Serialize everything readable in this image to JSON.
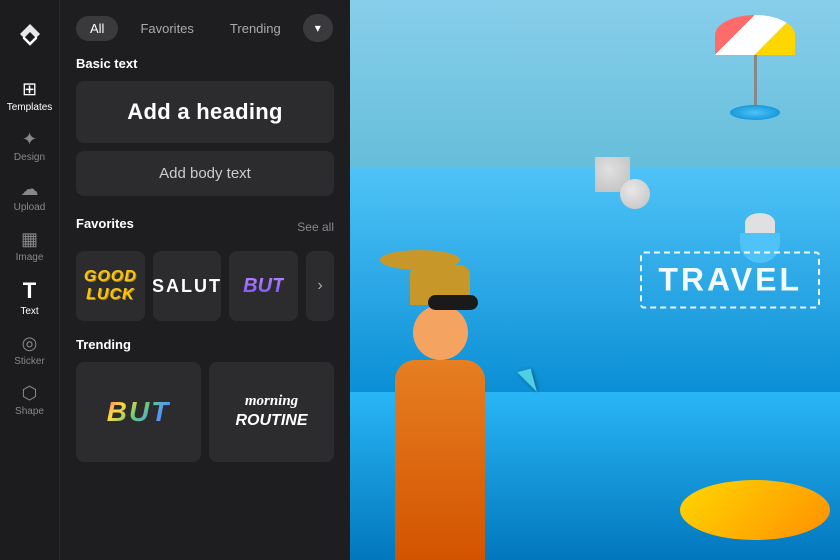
{
  "app": {
    "logo_symbol": "✂",
    "title": "CapCut"
  },
  "sidebar": {
    "items": [
      {
        "id": "templates",
        "label": "Templates",
        "icon": "⊞",
        "active": true
      },
      {
        "id": "design",
        "label": "Design",
        "icon": "✦",
        "active": false
      },
      {
        "id": "upload",
        "label": "Upload",
        "icon": "☁",
        "active": false
      },
      {
        "id": "image",
        "label": "Image",
        "icon": "▦",
        "active": false
      },
      {
        "id": "text",
        "label": "Text",
        "icon": "T",
        "active": true
      },
      {
        "id": "sticker",
        "label": "Sticker",
        "icon": "◎",
        "active": false
      },
      {
        "id": "shape",
        "label": "Shape",
        "icon": "⬡",
        "active": false
      }
    ]
  },
  "panel": {
    "filters": [
      {
        "id": "all",
        "label": "All",
        "active": true
      },
      {
        "id": "favorites",
        "label": "Favorites",
        "active": false
      },
      {
        "id": "trending",
        "label": "Trending",
        "active": false
      }
    ],
    "dropdown_icon": "▾",
    "sections": {
      "basic_text": {
        "title": "Basic text",
        "heading_btn": "Add a heading",
        "body_btn": "Add body text"
      },
      "favorites": {
        "title": "Favorites",
        "see_all": "See all",
        "items": [
          {
            "id": "good-luck",
            "text": "GOOD\nLUCK"
          },
          {
            "id": "salut",
            "text": "SALUT"
          },
          {
            "id": "but",
            "text": "BUT"
          }
        ],
        "arrow_icon": "›"
      },
      "trending": {
        "title": "Trending",
        "items": [
          {
            "id": "but-trend",
            "text": "BUT"
          },
          {
            "id": "morning-routine",
            "text": "morning\nROUTINE"
          }
        ]
      }
    }
  },
  "canvas": {
    "travel_text": "TRAVEL",
    "cursor_visible": true
  }
}
